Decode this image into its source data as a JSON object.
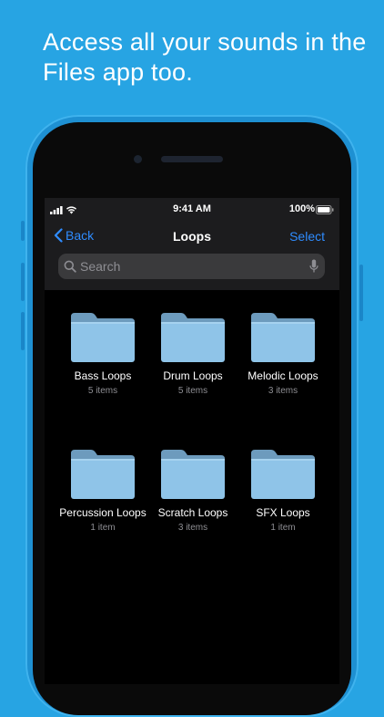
{
  "headline": "Access all your sounds in the Files app too.",
  "status": {
    "time": "9:41 AM",
    "battery": "100%"
  },
  "nav": {
    "back_label": "Back",
    "title": "Loops",
    "select_label": "Select"
  },
  "search": {
    "placeholder": "Search"
  },
  "folders": [
    {
      "name": "Bass Loops",
      "count": "5 items"
    },
    {
      "name": "Drum Loops",
      "count": "5 items"
    },
    {
      "name": "Melodic Loops",
      "count": "3 items"
    },
    {
      "name": "Percussion Loops",
      "count": "1 item"
    },
    {
      "name": "Scratch Loops",
      "count": "3 items"
    },
    {
      "name": "SFX Loops",
      "count": "1 item"
    }
  ],
  "colors": {
    "background": "#27a4e3",
    "accent": "#2f8cff",
    "folder": "#8fc4e8"
  },
  "icons": [
    "signal-icon",
    "wifi-icon",
    "battery-icon",
    "chevron-left-icon",
    "search-icon",
    "microphone-icon",
    "folder-icon"
  ]
}
